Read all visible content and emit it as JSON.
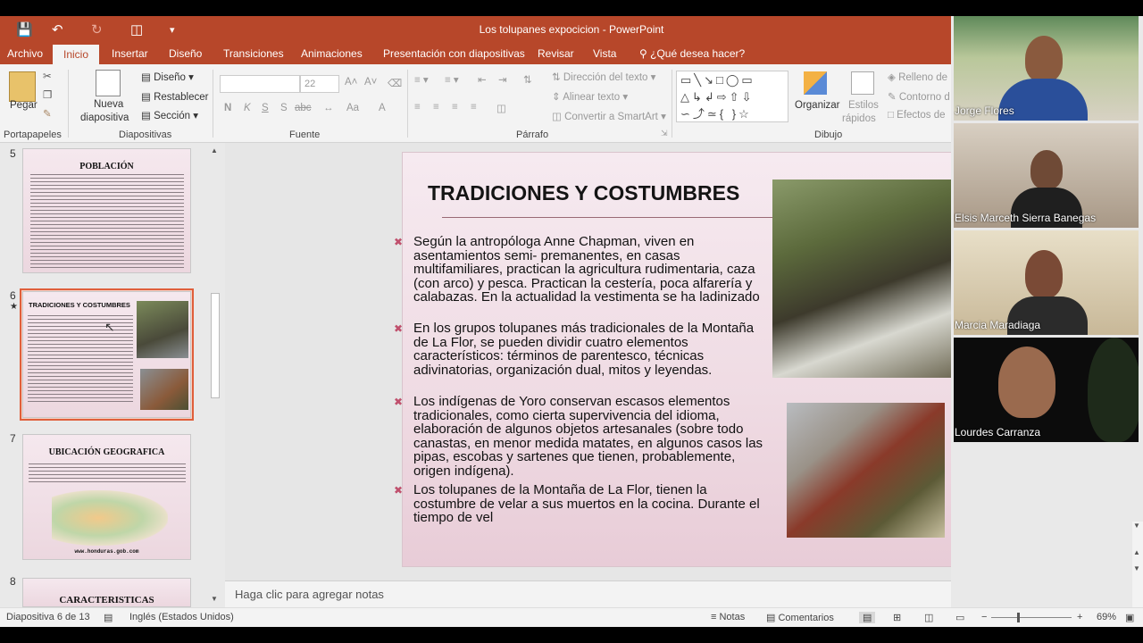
{
  "app": {
    "title": "Los tolupanes expocicion - PowerPoint",
    "colors": {
      "accent": "#b7472a",
      "slide_bg": "#f2e1e8",
      "bullet": "#c0506d"
    }
  },
  "tabs": [
    "Archivo",
    "Inicio",
    "Insertar",
    "Diseño",
    "Transiciones",
    "Animaciones",
    "Presentación con diapositivas",
    "Revisar",
    "Vista"
  ],
  "tell_me": "¿Qué desea hacer?",
  "ribbon": {
    "clipboard": {
      "paste": "Pegar",
      "group": "Portapapeles"
    },
    "slides": {
      "new_slide_1": "Nueva",
      "new_slide_2": "diapositiva",
      "layout": "Diseño",
      "reset": "Restablecer",
      "section": "Sección",
      "group": "Diapositivas"
    },
    "font": {
      "size": "22",
      "bold": "N",
      "italic": "K",
      "underline": "S",
      "strike": "S",
      "spacing": "abc",
      "case": "Aa",
      "group": "Fuente"
    },
    "paragraph": {
      "text_direction": "Dirección del texto",
      "align_text": "Alinear texto",
      "smartart": "Convertir a SmartArt",
      "group": "Párrafo"
    },
    "drawing": {
      "arrange": "Organizar",
      "quick_styles_1": "Estilos",
      "quick_styles_2": "rápidos",
      "fill": "Relleno de",
      "outline": "Contorno d",
      "effects": "Efectos de",
      "group": "Dibujo"
    }
  },
  "thumbnails": [
    {
      "num": "5",
      "title": "POBLACIÓN"
    },
    {
      "num": "6",
      "title": "TRADICIONES Y COSTUMBRES"
    },
    {
      "num": "7",
      "title": "UBICACIÓN GEOGRAFICA",
      "caption": "www.honduras.gob.com"
    },
    {
      "num": "8",
      "title": "CARACTERISTICAS"
    }
  ],
  "slide": {
    "title": "TRADICIONES Y COSTUMBRES",
    "bullets": [
      "Según la antropóloga Anne Chapman, viven en asentamientos semi- premanentes, en casas multifamiliares, practican la agricultura rudimentaria, caza (con arco) y pesca. Practican la cestería, poca alfarería y calabazas. En la actualidad la vestimenta se ha ladinizado",
      "En los grupos tolupanes más tradicionales de la Montaña de La Flor, se pueden dividir cuatro elementos característicos: términos de parentesco, técnicas adivinatorias, organización dual, mitos y leyendas.",
      "Los indígenas de Yoro conservan escasos elementos tradicionales, como cierta supervivencia del idioma, elaboración de algunos objetos artesanales (sobre todo canastas, en menor medida matates, en algunos casos las pipas, escobas y sartenes que tienen, probablemente, origen indígena).",
      "Los tolupanes de la Montaña de La Flor, tienen la costumbre de velar a sus muertos en la cocina. Durante el tiempo de vel"
    ]
  },
  "notes_placeholder": "Haga clic para agregar notas",
  "status": {
    "slide_info": "Diapositiva 6 de 13",
    "language": "Inglés (Estados Unidos)",
    "notes": "Notas",
    "comments": "Comentarios",
    "zoom": "69%"
  },
  "participants": [
    "Jorge Flores",
    "Elsis Marceth Sierra Banegas",
    "Marcia Maradiaga",
    "Lourdes Carranza"
  ]
}
